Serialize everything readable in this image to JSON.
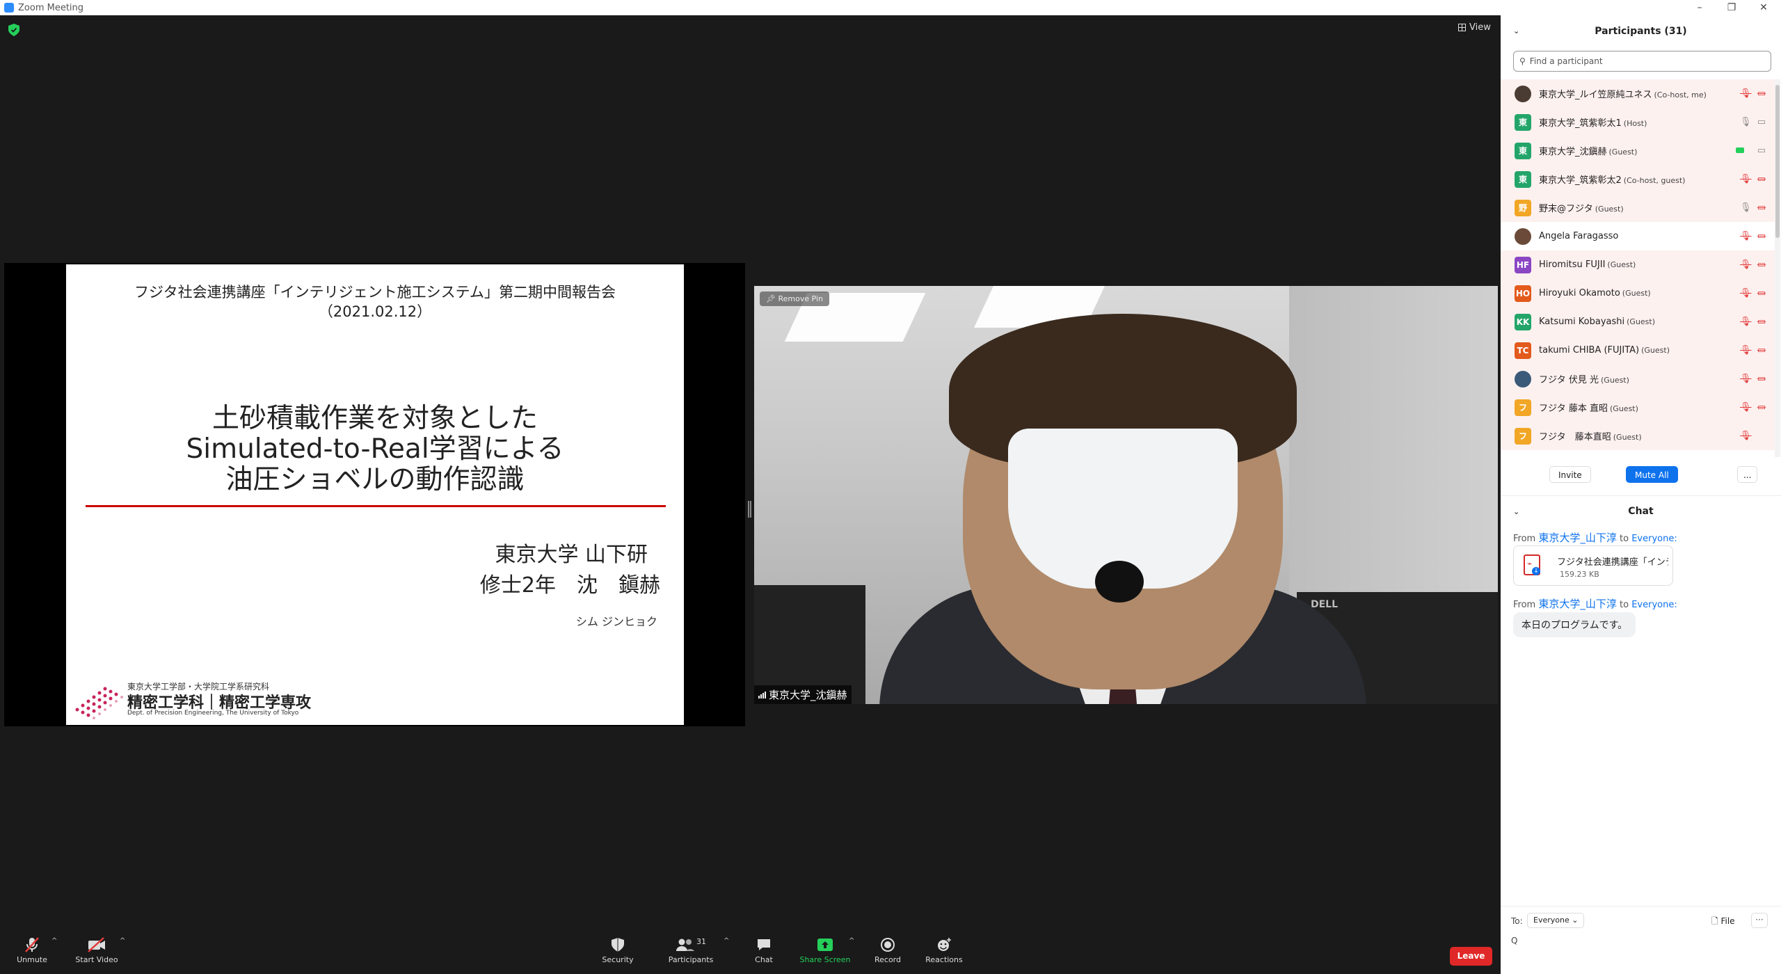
{
  "window": {
    "title": "Zoom Meeting"
  },
  "stage": {
    "view_label": "View"
  },
  "slide": {
    "header_line1": "フジタ社会連携講座「インテリジェント施工システム」第二期中間報告会",
    "header_line2": "（2021.02.12）",
    "title_line1": "土砂積載作業を対象とした",
    "title_line2": "Simulated-to-Real学習による",
    "title_line3": "油圧ショベルの動作認識",
    "affiliation": "東京大学 山下研",
    "presenter": "修士2年　沈　鎭赫",
    "presenter_kana": "シム ジンヒョク",
    "logo_line1": "東京大学工学部・大学院工学系研究科",
    "logo_line2": "精密工学科｜精密工学専攻",
    "logo_line3": "Dept. of Precision Engineering, The University of Tokyo"
  },
  "video": {
    "remove_pin_label": "Remove Pin",
    "name": "東京大学_沈鎭赫",
    "monitor_brand": "DELL"
  },
  "toolbar": {
    "unmute": "Unmute",
    "start_video": "Start Video",
    "security": "Security",
    "participants": "Participants",
    "participants_count": "31",
    "chat": "Chat",
    "share_screen": "Share Screen",
    "record": "Record",
    "reactions": "Reactions",
    "leave": "Leave"
  },
  "colors": {
    "share_green": "#24d05a",
    "leave_red": "#e02828",
    "link_blue": "#0e72ed",
    "muted_red": "#e23b3b"
  },
  "participants_panel": {
    "title": "Participants (31)",
    "search_placeholder": "Find a participant",
    "invite": "Invite",
    "mute_all": "Mute All",
    "more": "...",
    "list": [
      {
        "initials": "",
        "avatar_color": "#4a3b33",
        "name": "東京大学_ルイ笠原純ユネス",
        "role": "(Co-host, me)",
        "mic": "muted",
        "cam": "off",
        "photo": true
      },
      {
        "initials": "東",
        "avatar_color": "#23a56a",
        "name": "東京大学_筑紫彰太1",
        "role": "(Host)",
        "mic": "on",
        "cam": "on"
      },
      {
        "initials": "東",
        "avatar_color": "#23a56a",
        "name": "東京大学_沈鎭赫",
        "role": "(Guest)",
        "mic": "talking",
        "cam": "on"
      },
      {
        "initials": "東",
        "avatar_color": "#23a56a",
        "name": "東京大学_筑紫彰太2",
        "role": "(Co-host, guest)",
        "mic": "muted",
        "cam": "off"
      },
      {
        "initials": "野",
        "avatar_color": "#f2a626",
        "name": "野末@フジタ",
        "role": "(Guest)",
        "mic": "on",
        "cam": "off"
      },
      {
        "initials": "",
        "avatar_color": "#6b4a3a",
        "name": "Angela Faragasso",
        "role": "",
        "mic": "muted",
        "cam": "off",
        "photo": true
      },
      {
        "initials": "HF",
        "avatar_color": "#8b46c4",
        "name": "Hiromitsu FUJII",
        "role": "(Guest)",
        "mic": "muted",
        "cam": "off"
      },
      {
        "initials": "HO",
        "avatar_color": "#e25a1c",
        "name": "Hiroyuki Okamoto",
        "role": "(Guest)",
        "mic": "muted",
        "cam": "off"
      },
      {
        "initials": "KK",
        "avatar_color": "#23a56a",
        "name": "Katsumi Kobayashi",
        "role": "(Guest)",
        "mic": "muted",
        "cam": "off"
      },
      {
        "initials": "TC",
        "avatar_color": "#e25a1c",
        "name": "takumi CHIBA (FUJITA)",
        "role": "(Guest)",
        "mic": "muted",
        "cam": "off"
      },
      {
        "initials": "",
        "avatar_color": "#3b5a7a",
        "name": "フジタ 伏見 光",
        "role": "(Guest)",
        "mic": "muted",
        "cam": "off",
        "photo": true
      },
      {
        "initials": "フ",
        "avatar_color": "#f2a626",
        "name": "フジタ 藤本 直昭",
        "role": "(Guest)",
        "mic": "muted",
        "cam": "off"
      },
      {
        "initials": "フ",
        "avatar_color": "#f2a626",
        "name": "フジタ　藤本直昭",
        "role": "(Guest)",
        "mic": "muted",
        "cam": "none"
      }
    ]
  },
  "chat_panel": {
    "title": "Chat",
    "messages": [
      {
        "from_label": "From",
        "sender": "東京大学_山下淳",
        "to_label": "to",
        "recipient": "Everyone:",
        "file_name": "フジタ社会連携講座「インテリ...",
        "file_size": "159.23 KB"
      },
      {
        "from_label": "From",
        "sender": "東京大学_山下淳",
        "to_label": "to",
        "recipient": "Everyone:",
        "text": "本日のプログラムです。"
      }
    ],
    "to_label": "To:",
    "to_value": "Everyone",
    "file_label": "File",
    "more_label": "···"
  }
}
